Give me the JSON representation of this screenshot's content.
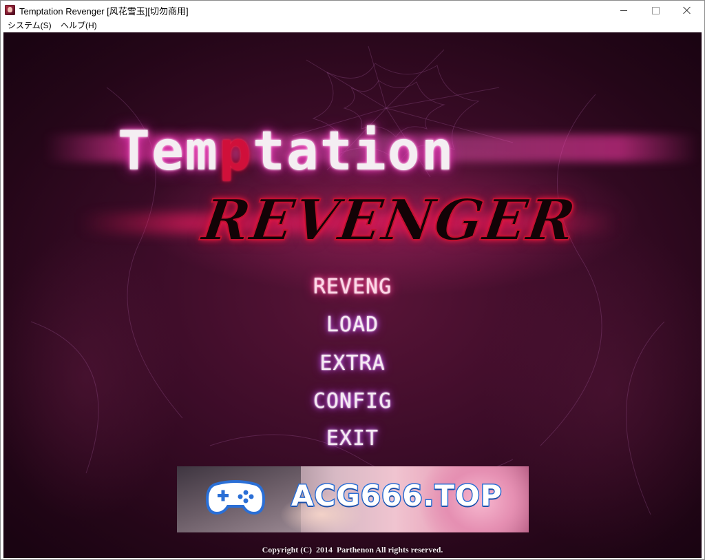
{
  "window": {
    "title": "Temptation Revenger [风花雪玉][切勿商用]",
    "minimize_label": "—",
    "maximize_label": "☐",
    "close_label": "✕"
  },
  "menubar": {
    "items": [
      {
        "label": "システム(S)"
      },
      {
        "label": "ヘルプ(H)"
      }
    ]
  },
  "game": {
    "logo_title_pre": "Tem",
    "logo_title_accent": "p",
    "logo_title_post": "tation",
    "logo_subtitle": "REVENGER",
    "menu": [
      {
        "label": "REVENG",
        "active": true
      },
      {
        "label": "LOAD",
        "active": false
      },
      {
        "label": "EXTRA",
        "active": false
      },
      {
        "label": "CONFIG",
        "active": false
      },
      {
        "label": "EXIT",
        "active": false
      }
    ],
    "banner_text": "ACG666.TOP",
    "banner_icon": "gamepad-icon",
    "copyright": "Copyright (C)  2014  Parthenon All rights reserved."
  },
  "colors": {
    "background": "#3c0c28",
    "menu_text": "#f6eaf4",
    "menu_glow": "#d060ff",
    "logo_accent": "#d0103a",
    "banner_text_stroke": "#2a6fd6"
  }
}
